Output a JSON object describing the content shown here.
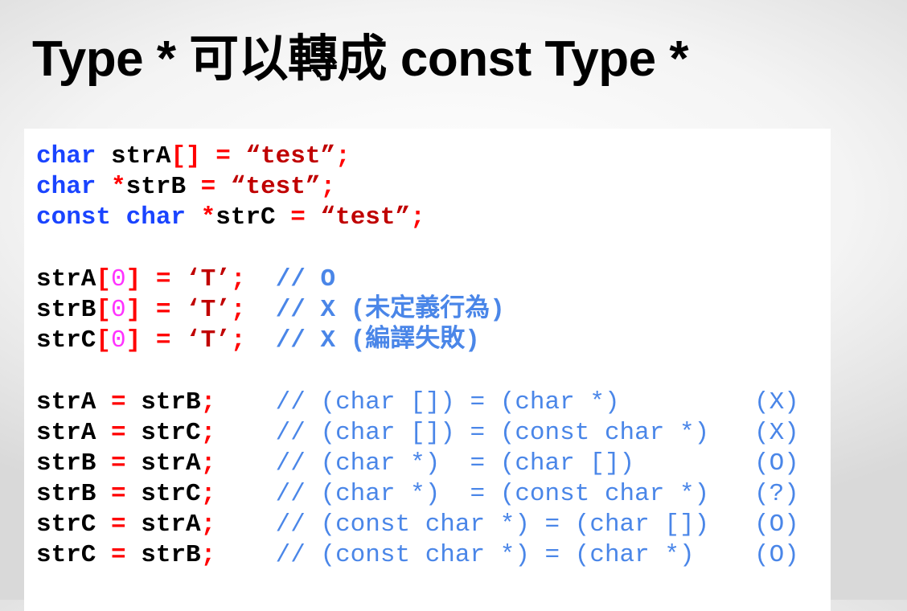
{
  "slide": {
    "title": "Type * 可以轉成 const Type *"
  },
  "code": {
    "lines": [
      [
        {
          "t": "char",
          "c": "kw"
        },
        {
          "t": " strA",
          "c": "id"
        },
        {
          "t": "[]",
          "c": "p"
        },
        {
          "t": " = ",
          "c": "p"
        },
        {
          "t": "“test”",
          "c": "str"
        },
        {
          "t": ";",
          "c": "p"
        }
      ],
      [
        {
          "t": "char",
          "c": "kw"
        },
        {
          "t": " *",
          "c": "p"
        },
        {
          "t": "strB",
          "c": "id"
        },
        {
          "t": " = ",
          "c": "p"
        },
        {
          "t": "“test”",
          "c": "str"
        },
        {
          "t": ";",
          "c": "p"
        }
      ],
      [
        {
          "t": "const char",
          "c": "kw"
        },
        {
          "t": " *",
          "c": "p"
        },
        {
          "t": "strC",
          "c": "id"
        },
        {
          "t": " = ",
          "c": "p"
        },
        {
          "t": "“test”",
          "c": "str"
        },
        {
          "t": ";",
          "c": "p"
        }
      ],
      [],
      [
        {
          "t": "strA",
          "c": "id"
        },
        {
          "t": "[",
          "c": "p"
        },
        {
          "t": "0",
          "c": "num"
        },
        {
          "t": "]",
          "c": "p"
        },
        {
          "t": " = ",
          "c": "p"
        },
        {
          "t": "‘T’",
          "c": "str"
        },
        {
          "t": ";  ",
          "c": "p"
        },
        {
          "t": "// O",
          "c": "cmb"
        }
      ],
      [
        {
          "t": "strB",
          "c": "id"
        },
        {
          "t": "[",
          "c": "p"
        },
        {
          "t": "0",
          "c": "num"
        },
        {
          "t": "]",
          "c": "p"
        },
        {
          "t": " = ",
          "c": "p"
        },
        {
          "t": "‘T’",
          "c": "str"
        },
        {
          "t": ";  ",
          "c": "p"
        },
        {
          "t": "// X (未定義行為)",
          "c": "cmb"
        }
      ],
      [
        {
          "t": "strC",
          "c": "id"
        },
        {
          "t": "[",
          "c": "p"
        },
        {
          "t": "0",
          "c": "num"
        },
        {
          "t": "]",
          "c": "p"
        },
        {
          "t": " = ",
          "c": "p"
        },
        {
          "t": "‘T’",
          "c": "str"
        },
        {
          "t": ";  ",
          "c": "p"
        },
        {
          "t": "// X (編譯失敗)",
          "c": "cmb"
        }
      ],
      [],
      [
        {
          "t": "strA",
          "c": "id"
        },
        {
          "t": " = ",
          "c": "p"
        },
        {
          "t": "strB",
          "c": "id"
        },
        {
          "t": ";    ",
          "c": "p"
        },
        {
          "t": "// (char []) = (char *)         (X)",
          "c": "cm"
        }
      ],
      [
        {
          "t": "strA",
          "c": "id"
        },
        {
          "t": " = ",
          "c": "p"
        },
        {
          "t": "strC",
          "c": "id"
        },
        {
          "t": ";    ",
          "c": "p"
        },
        {
          "t": "// (char []) = (const char *)   (X)",
          "c": "cm"
        }
      ],
      [
        {
          "t": "strB",
          "c": "id"
        },
        {
          "t": " = ",
          "c": "p"
        },
        {
          "t": "strA",
          "c": "id"
        },
        {
          "t": ";    ",
          "c": "p"
        },
        {
          "t": "// (char *)  = (char [])        (O)",
          "c": "cm"
        }
      ],
      [
        {
          "t": "strB",
          "c": "id"
        },
        {
          "t": " = ",
          "c": "p"
        },
        {
          "t": "strC",
          "c": "id"
        },
        {
          "t": ";    ",
          "c": "p"
        },
        {
          "t": "// (char *)  = (const char *)   (?)",
          "c": "cm"
        }
      ],
      [
        {
          "t": "strC",
          "c": "id"
        },
        {
          "t": " = ",
          "c": "p"
        },
        {
          "t": "strA",
          "c": "id"
        },
        {
          "t": ";    ",
          "c": "p"
        },
        {
          "t": "// (const char *) = (char [])   (O)",
          "c": "cm"
        }
      ],
      [
        {
          "t": "strC",
          "c": "id"
        },
        {
          "t": " = ",
          "c": "p"
        },
        {
          "t": "strB",
          "c": "id"
        },
        {
          "t": ";    ",
          "c": "p"
        },
        {
          "t": "// (const char *) = (char *)    (O)",
          "c": "cm"
        }
      ]
    ]
  },
  "colors": {
    "keyword": "#1a44ff",
    "identifier": "#000000",
    "punctuation": "#ff0000",
    "string": "#c00000",
    "number": "#ff33ff",
    "comment": "#4a86e8"
  }
}
